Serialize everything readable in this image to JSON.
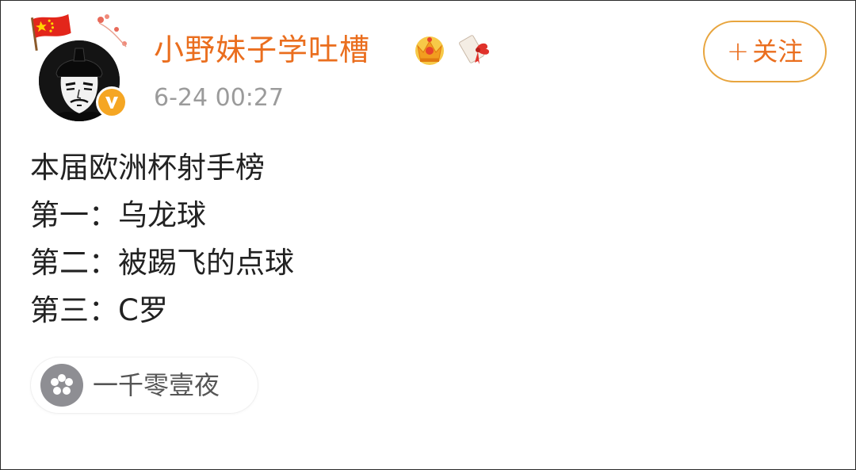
{
  "post": {
    "author": {
      "name": "小野妹子学吐槽",
      "avatar_icon": "emperor-portrait-avatar",
      "verified_icon": "verified-v-badge",
      "badges": [
        "crown-icon",
        "gift-scroll-icon"
      ],
      "flag_icon": "red-flag-icon"
    },
    "timestamp": "6-24 00:27",
    "follow_button": {
      "plus": "+",
      "label": "关注"
    },
    "content": {
      "lines": [
        "本届欧洲杯射手榜",
        "第一：乌龙球",
        "第二：被踢飞的点球",
        "第三：C罗"
      ]
    },
    "topic_chip": {
      "icon": "flower-icon",
      "label": "一千零壹夜"
    }
  },
  "colors": {
    "accent": "#ea6e1e",
    "follow_border": "#e8a53e",
    "timestamp": "#9b9b9b",
    "body_text": "#222222",
    "verified": "#f5a623",
    "chip_icon_bg": "#8e8e93"
  }
}
